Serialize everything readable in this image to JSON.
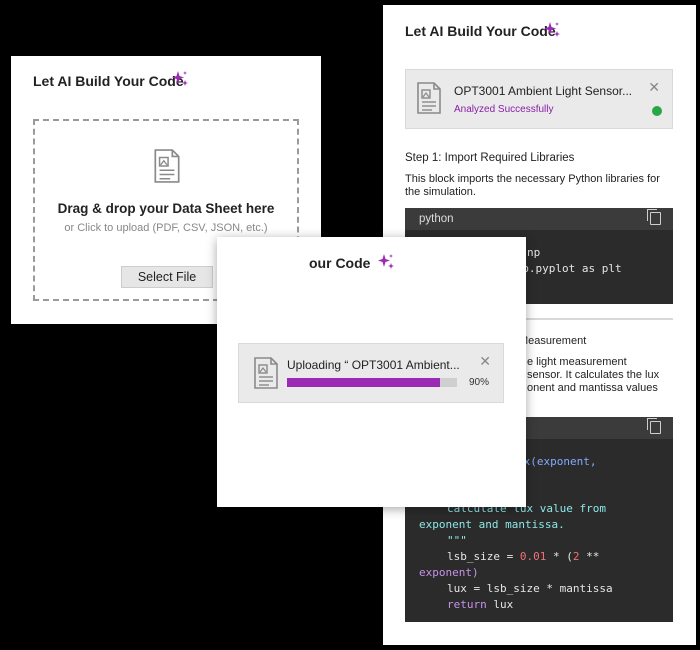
{
  "accent_color": "#9b2bb5",
  "success_color": "#29a745",
  "right_panel": {
    "title": "Let AI Build Your Code",
    "file_name": "OPT3001 Ambient Light Sensor...",
    "file_status": "Analyzed Successfully",
    "step1_title": "Step 1: Import Required Libraries",
    "step1_desc": "This block imports the necessary Python libraries for the simulation.",
    "code1_lang": "python",
    "code1_lines": [
      "np",
      "lib.pyplot as plt"
    ],
    "step2_title_fragment": "Measurement",
    "step2_desc_lines": [
      "e light measurement",
      " sensor. It calculates the lux",
      "onent and mantissa values"
    ],
    "code2_lines": {
      "l1": "ux(exponent,",
      "l2": "calculate lux value from",
      "l3": "exponent and mantissa.",
      "l4": "\"\"\"",
      "l5a": "lsb_size = ",
      "l5b": "0.01",
      "l5c": " * (",
      "l5d": "2",
      "l5e": " **",
      "l6": "exponent)",
      "l7": "lux = lsb_size * mantissa",
      "l8a": "return",
      "l8b": " lux"
    }
  },
  "upload_card": {
    "title": "Let AI Build Your Code",
    "drag_text": "Drag & drop your Data Sheet here",
    "or_text": "or Click to upload (PDF, CSV, JSON, etc.)",
    "button_label": "Select File"
  },
  "uploading_card": {
    "title_fragment": "our Code",
    "uploading_text": "Uploading “ OPT3001 Ambient...",
    "progress_percent": 90,
    "progress_label": "90%"
  }
}
